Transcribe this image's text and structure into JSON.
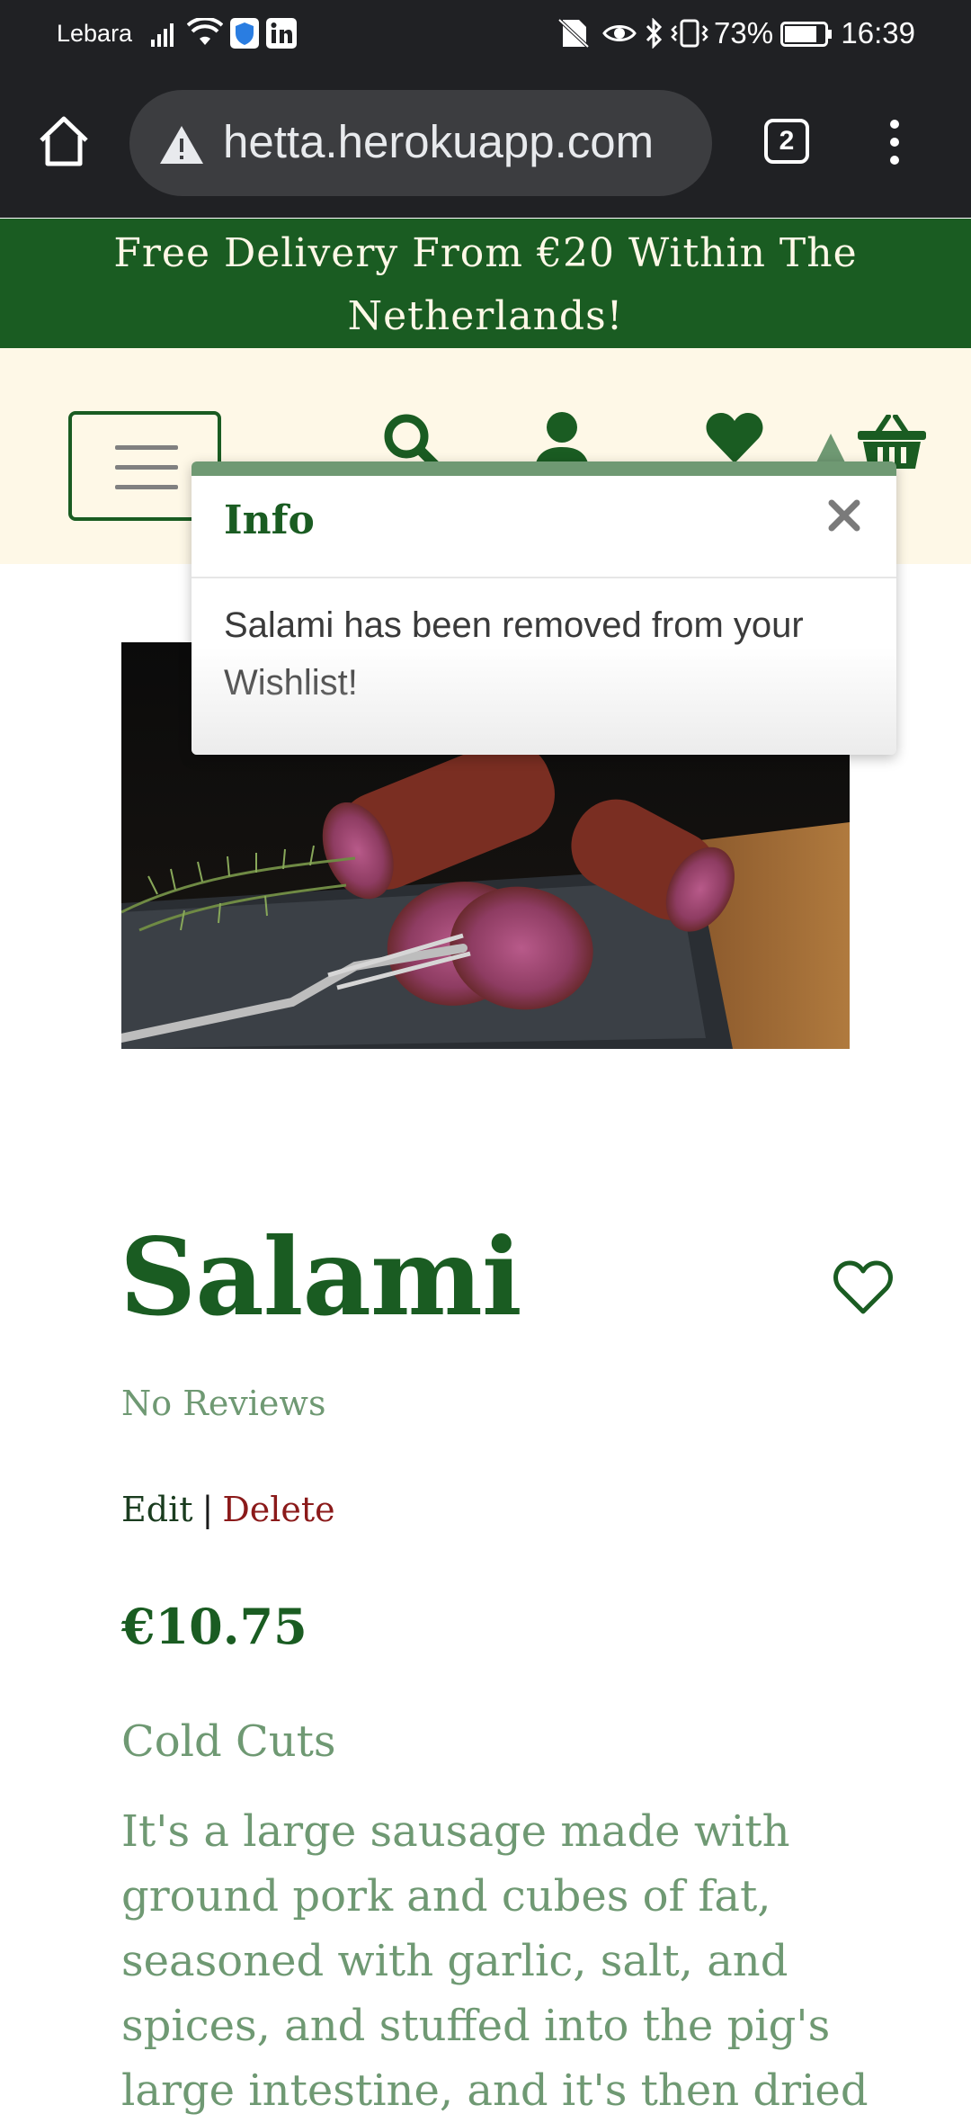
{
  "status_bar": {
    "carrier": "Lebara",
    "battery_percent": "73%",
    "time": "16:39",
    "icons": [
      "signal-icon",
      "wifi-icon",
      "shield-icon",
      "linkedin-icon",
      "no-sim-icon",
      "eye-icon",
      "bluetooth-icon",
      "vibrate-icon",
      "battery-icon"
    ]
  },
  "browser": {
    "url": "hetta.herokuapp.com",
    "tab_count": "2"
  },
  "banner": {
    "line1": "Free Delivery From €20 Within The",
    "line2": "Netherlands!"
  },
  "header": {
    "icons": [
      "menu-icon",
      "search-icon",
      "user-icon",
      "heart-icon",
      "basket-icon"
    ]
  },
  "popover": {
    "title": "Info",
    "message": "Salami has been removed from your Wishlist!"
  },
  "product": {
    "name": "Salami",
    "reviews": "No Reviews",
    "edit_label": "Edit",
    "separator": "|",
    "delete_label": "Delete",
    "price": "€10.75",
    "category": "Cold Cuts",
    "description": "It's a large sausage made with ground pork and cubes of fat, seasoned with garlic, salt, and spices, and stuffed into the pig's large intestine, and it's then dried"
  },
  "colors": {
    "brand_green": "#1a5c22",
    "muted_green": "#6f9973",
    "cream": "#fef8e7",
    "delete_red": "#8b1a1a"
  }
}
